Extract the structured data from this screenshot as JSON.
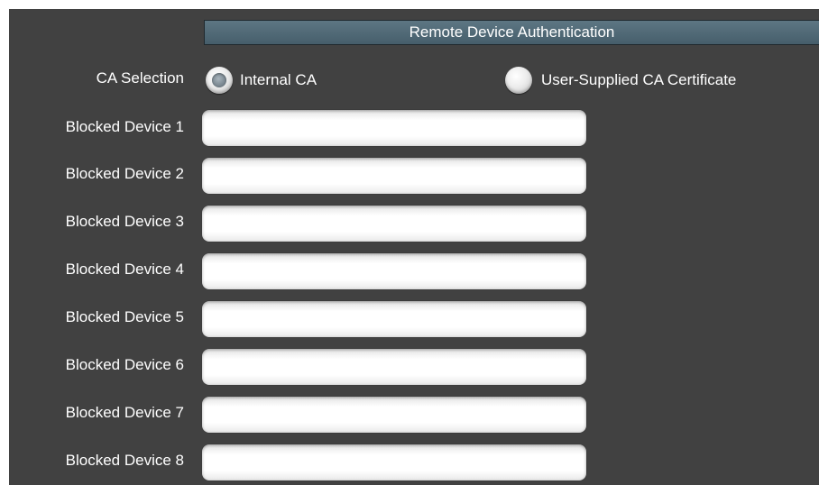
{
  "section": {
    "title": "Remote Device Authentication"
  },
  "ca_selection": {
    "label": "CA Selection",
    "options": [
      {
        "label": "Internal CA",
        "selected": true
      },
      {
        "label": "User-Supplied CA Certificate",
        "selected": false
      }
    ]
  },
  "blocked_devices": [
    {
      "label": "Blocked Device 1",
      "value": ""
    },
    {
      "label": "Blocked Device 2",
      "value": ""
    },
    {
      "label": "Blocked Device 3",
      "value": ""
    },
    {
      "label": "Blocked Device 4",
      "value": ""
    },
    {
      "label": "Blocked Device 5",
      "value": ""
    },
    {
      "label": "Blocked Device 6",
      "value": ""
    },
    {
      "label": "Blocked Device 7",
      "value": ""
    },
    {
      "label": "Blocked Device 8",
      "value": ""
    }
  ],
  "colors": {
    "panel_background": "#414141",
    "header_background": "#536b78",
    "text": "#ffffff",
    "radio_selected_dot": "#7d8a93"
  }
}
